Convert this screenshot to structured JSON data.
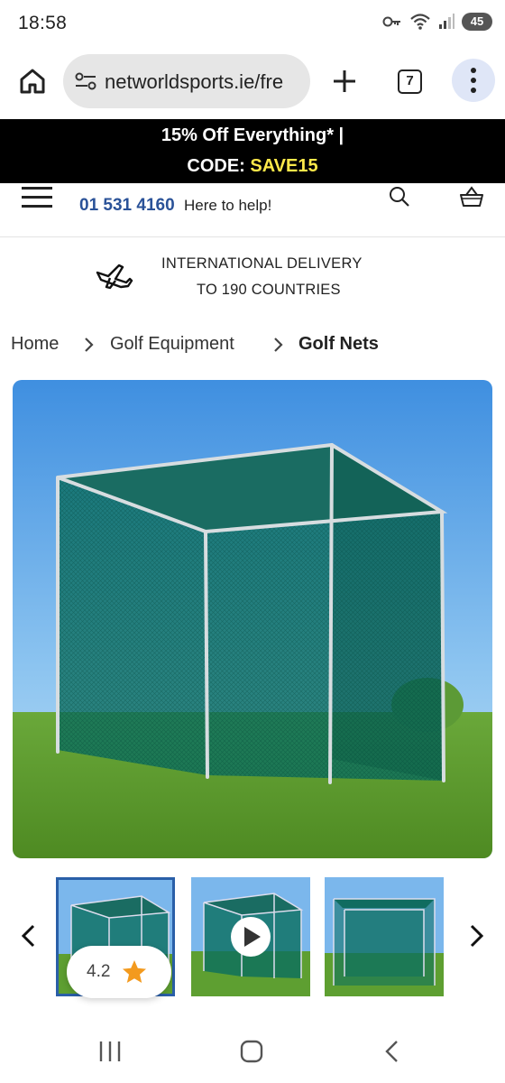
{
  "status_bar": {
    "time": "18:58",
    "battery": "45",
    "icons": [
      "key-icon",
      "wifi-icon",
      "signal-icon",
      "battery-icon"
    ]
  },
  "browser": {
    "url": "networldsports.ie/fre",
    "tab_count": "7",
    "icons": [
      "home-icon",
      "tune-icon",
      "plus-icon",
      "tabs-icon",
      "more-vert-icon"
    ]
  },
  "promo": {
    "line1": "15% Off Everything* |",
    "code_label": "CODE: ",
    "code_value": "SAVE15",
    "code_color": "#ffe94a"
  },
  "header": {
    "phone": "01 531 4160",
    "help_text": "Here to help!",
    "brand_color": "#2a5298",
    "icons": [
      "menu-icon",
      "search-icon",
      "basket-icon"
    ]
  },
  "delivery": {
    "line1": "INTERNATIONAL DELIVERY",
    "line2": "TO 190 COUNTRIES",
    "icon": "plane-icon"
  },
  "breadcrumb": {
    "items": [
      "Home",
      "Golf Equipment",
      "Golf Nets"
    ]
  },
  "product": {
    "rating": "4.2",
    "rating_star_color": "#f39a1e",
    "thumbnails": [
      "golf-net-front",
      "golf-net-video",
      "golf-net-rear"
    ]
  },
  "android_nav": {
    "icons": [
      "recent-apps-icon",
      "home-circle-icon",
      "back-icon"
    ]
  }
}
